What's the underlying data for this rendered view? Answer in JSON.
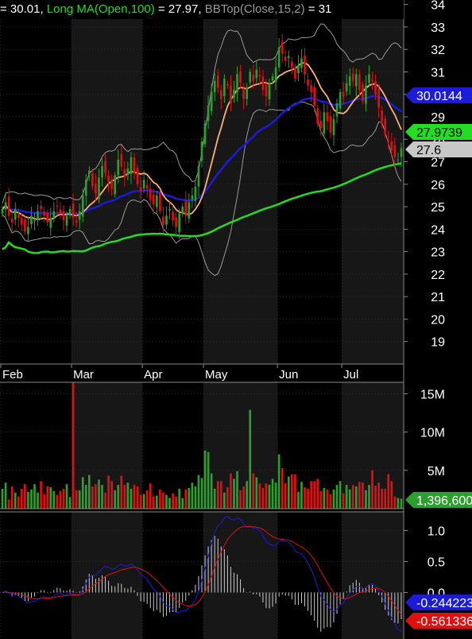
{
  "header": {
    "prefix": "= 30.01, ",
    "ma_label": "Long MA(Open,100)",
    "ma_value": " = 27.97, ",
    "bb_label": "BBTop(Close,15,2)",
    "bb_value": " = 31"
  },
  "colors": {
    "background": "#000000",
    "up": "#2ca02c",
    "down": "#e01010",
    "short_ma": "#ffb070",
    "mid_ma": "#1c1cd8",
    "long_ma": "#22dd22",
    "bands": "#9a9a9a",
    "macd": "#1c1cd8",
    "signal": "#e01010",
    "hist": "#cccccc"
  },
  "chart_data": [
    {
      "type": "candlestick",
      "panel": "price",
      "y_ticks": [
        19,
        20,
        21,
        22,
        23,
        24,
        25,
        26,
        27,
        28,
        29,
        30,
        31,
        32,
        33,
        34
      ],
      "ylim": [
        18.0,
        34.2
      ],
      "x_labels": [
        {
          "label": "Feb",
          "day": 0
        },
        {
          "label": "Mar",
          "day": 22
        },
        {
          "label": "Apr",
          "day": 44
        },
        {
          "label": "May",
          "day": 63
        },
        {
          "label": "Jun",
          "day": 86
        },
        {
          "label": "Jul",
          "day": 106
        }
      ],
      "n_days": 125,
      "close": [
        24.9,
        25.2,
        24.6,
        24.3,
        24.9,
        24.5,
        24.2,
        23.9,
        24.1,
        24.6,
        24.4,
        24.8,
        24.9,
        24.6,
        24.3,
        24.5,
        24.8,
        25.0,
        24.7,
        24.4,
        24.6,
        24.9,
        24.5,
        24.3,
        24.8,
        25.5,
        26.2,
        26.6,
        25.9,
        25.6,
        26.3,
        26.8,
        26.5,
        26.1,
        25.8,
        26.4,
        27.1,
        26.8,
        26.3,
        26.7,
        27.2,
        26.5,
        26.0,
        25.7,
        26.2,
        25.8,
        25.3,
        25.1,
        25.5,
        24.8,
        24.2,
        24.6,
        24.9,
        24.4,
        24.1,
        24.7,
        25.0,
        24.6,
        25.2,
        25.5,
        25.9,
        26.8,
        27.9,
        28.7,
        29.5,
        30.1,
        30.6,
        30.3,
        29.8,
        30.7,
        30.4,
        29.6,
        30.2,
        30.9,
        30.5,
        29.8,
        30.3,
        31.0,
        30.6,
        31.1,
        30.8,
        30.2,
        29.9,
        30.5,
        30.8,
        31.2,
        32.1,
        31.8,
        31.5,
        31.7,
        31.2,
        30.7,
        31.3,
        31.6,
        30.9,
        30.4,
        30.1,
        29.5,
        28.7,
        28.5,
        29.2,
        28.8,
        28.3,
        28.9,
        29.6,
        30.1,
        29.9,
        30.5,
        30.8,
        30.6,
        30.9,
        30.2,
        29.7,
        30.4,
        30.9,
        30.6,
        30.0,
        29.4,
        28.8,
        28.2,
        27.9,
        27.5,
        27.2,
        27.1,
        27.6
      ],
      "series": [
        {
          "name": "Long MA(Open,100)"
        },
        {
          "name": "BBTop(Close,15,2)"
        }
      ],
      "value_labels": [
        "30.0144",
        "27.9739",
        "27.6"
      ]
    },
    {
      "type": "bar",
      "panel": "volume",
      "y_ticks": [
        5,
        10,
        15
      ],
      "y_tick_labels": [
        "5M",
        "10M",
        "15M"
      ],
      "ylim": [
        0,
        16.5
      ],
      "unit": "M",
      "values": [
        2.6,
        3.4,
        1.2,
        2.9,
        2.1,
        1.6,
        2.6,
        3.2,
        2.2,
        2.5,
        3.2,
        2.1,
        3.6,
        1.9,
        2.9,
        2.8,
        2.3,
        1.8,
        2.3,
        2.6,
        3.2,
        1.5,
        16.8,
        2.4,
        2.4,
        4.1,
        3.1,
        4.4,
        2.9,
        3.2,
        3.8,
        3.1,
        2.1,
        4.3,
        3.6,
        2.4,
        3.1,
        4.3,
        3.1,
        3.4,
        2.6,
        3.1,
        2.9,
        1.8,
        1.9,
        2.4,
        3.3,
        1.6,
        1.7,
        2.5,
        2.1,
        1.8,
        1.4,
        2.0,
        1.6,
        2.6,
        1.4,
        2.5,
        2.7,
        3.4,
        2.9,
        4.4,
        4.0,
        7.6,
        7.4,
        4.6,
        2.6,
        3.6,
        3.6,
        2.1,
        2.8,
        4.6,
        3.9,
        4.9,
        2.4,
        2.9,
        3.6,
        12.9,
        4.6,
        4.1,
        3.3,
        2.7,
        3.3,
        3.1,
        3.9,
        3.4,
        7.1,
        5.3,
        3.3,
        4.2,
        4.5,
        4.5,
        2.2,
        3.5,
        2.8,
        2.6,
        3.6,
        3.6,
        3.9,
        2.3,
        2.7,
        2.5,
        1.9,
        2.5,
        3.1,
        3.6,
        2.0,
        3.1,
        2.5,
        3.1,
        2.9,
        3.5,
        3.4,
        2.4,
        3.1,
        5.0,
        3.0,
        3.4,
        2.6,
        2.6,
        4.5,
        3.6,
        1.6,
        1.4,
        1.3
      ],
      "value_labels": [
        "1,396,600"
      ]
    },
    {
      "type": "line",
      "panel": "macd",
      "y_ticks": [
        0.0,
        0.5,
        1.0
      ],
      "y_tick_labels": [
        "0.0",
        "0.5",
        "1.0"
      ],
      "ylim": [
        -0.75,
        1.3
      ],
      "value_labels": [
        "-0.244223",
        "-0.561336"
      ]
    }
  ]
}
